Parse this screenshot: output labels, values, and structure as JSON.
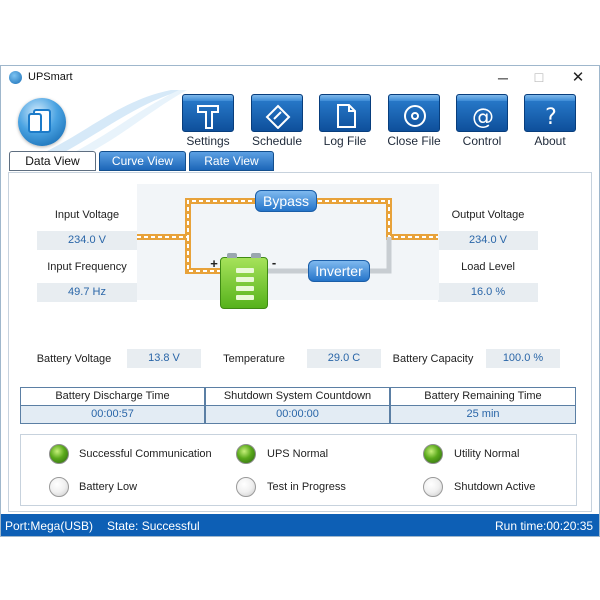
{
  "window": {
    "title": "UPSmart",
    "min": "─",
    "max": "☐",
    "close": "✕"
  },
  "toolbar": [
    {
      "label": "Settings",
      "icon": "hammer-icon"
    },
    {
      "label": "Schedule",
      "icon": "pencil-icon"
    },
    {
      "label": "Log File",
      "icon": "document-icon"
    },
    {
      "label": "Close File",
      "icon": "disc-icon"
    },
    {
      "label": "Control",
      "icon": "at-icon"
    },
    {
      "label": "About",
      "icon": "question-icon"
    }
  ],
  "tabs": [
    {
      "label": "Data View",
      "active": true
    },
    {
      "label": "Curve View",
      "active": false
    },
    {
      "label": "Rate View",
      "active": false
    }
  ],
  "input": {
    "voltage_label": "Input Voltage",
    "voltage_value": "234.0 V",
    "frequency_label": "Input Frequency",
    "frequency_value": "49.7 Hz"
  },
  "output": {
    "voltage_label": "Output Voltage",
    "voltage_value": "234.0 V",
    "load_label": "Load Level",
    "load_value": "16.0 %"
  },
  "flow": {
    "bypass": "Bypass",
    "inverter": "Inverter",
    "plus": "+",
    "minus": "-"
  },
  "metrics": {
    "battery_voltage_label": "Battery Voltage",
    "battery_voltage_value": "13.8 V",
    "temperature_label": "Temperature",
    "temperature_value": "29.0 C",
    "battery_capacity_label": "Battery Capacity",
    "battery_capacity_value": "100.0 %"
  },
  "timers": [
    {
      "header": "Battery Discharge Time",
      "value": "00:00:57"
    },
    {
      "header": "Shutdown System Countdown",
      "value": "00:00:00"
    },
    {
      "header": "Battery Remaining Time",
      "value": "25 min"
    }
  ],
  "indicators": [
    {
      "label": "Successful Communication",
      "on": true
    },
    {
      "label": "UPS Normal",
      "on": true
    },
    {
      "label": "Utility Normal",
      "on": true
    },
    {
      "label": "Battery Low",
      "on": false
    },
    {
      "label": "Test in Progress",
      "on": false
    },
    {
      "label": "Shutdown Active",
      "on": false
    }
  ],
  "colors": {
    "accent": "#0d5fb5",
    "value_text": "#2a66a8",
    "wire": "#e8a23a",
    "led_on": "#5aa91b"
  },
  "statusbar": {
    "port": "Port:Mega(USB)",
    "state": "State: Successful",
    "runtime": "Run time:00:20:35"
  }
}
